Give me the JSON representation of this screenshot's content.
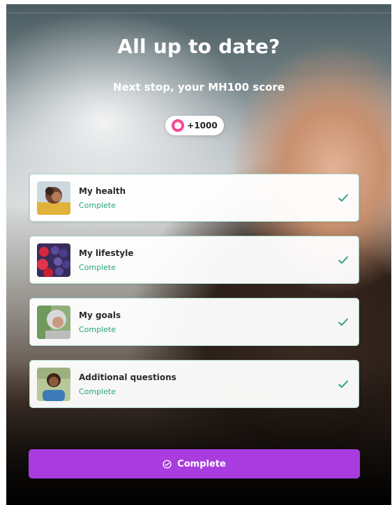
{
  "header": {
    "title": "All up to date?",
    "subtitle": "Next stop, your MH100 score"
  },
  "reward": {
    "label": "+1000",
    "icon": "points-ring-icon",
    "gradient": [
      "#ff7a59",
      "#ff4d86",
      "#c23bd6"
    ]
  },
  "sections": [
    {
      "title": "My health",
      "status": "Complete",
      "thumb": "person-with-curly-hair-photo"
    },
    {
      "title": "My lifestyle",
      "status": "Complete",
      "thumb": "berries-photo"
    },
    {
      "title": "My goals",
      "status": "Complete",
      "thumb": "woman-grey-hair-photo"
    },
    {
      "title": "Additional questions",
      "status": "Complete",
      "thumb": "smiling-woman-photo"
    }
  ],
  "footer": {
    "button_label": "Complete",
    "button_icon": "check-circle-icon"
  },
  "colors": {
    "accent_purple": "#a93cde",
    "complete_green": "#2aa37a",
    "card_border": "#a9d9c8"
  }
}
